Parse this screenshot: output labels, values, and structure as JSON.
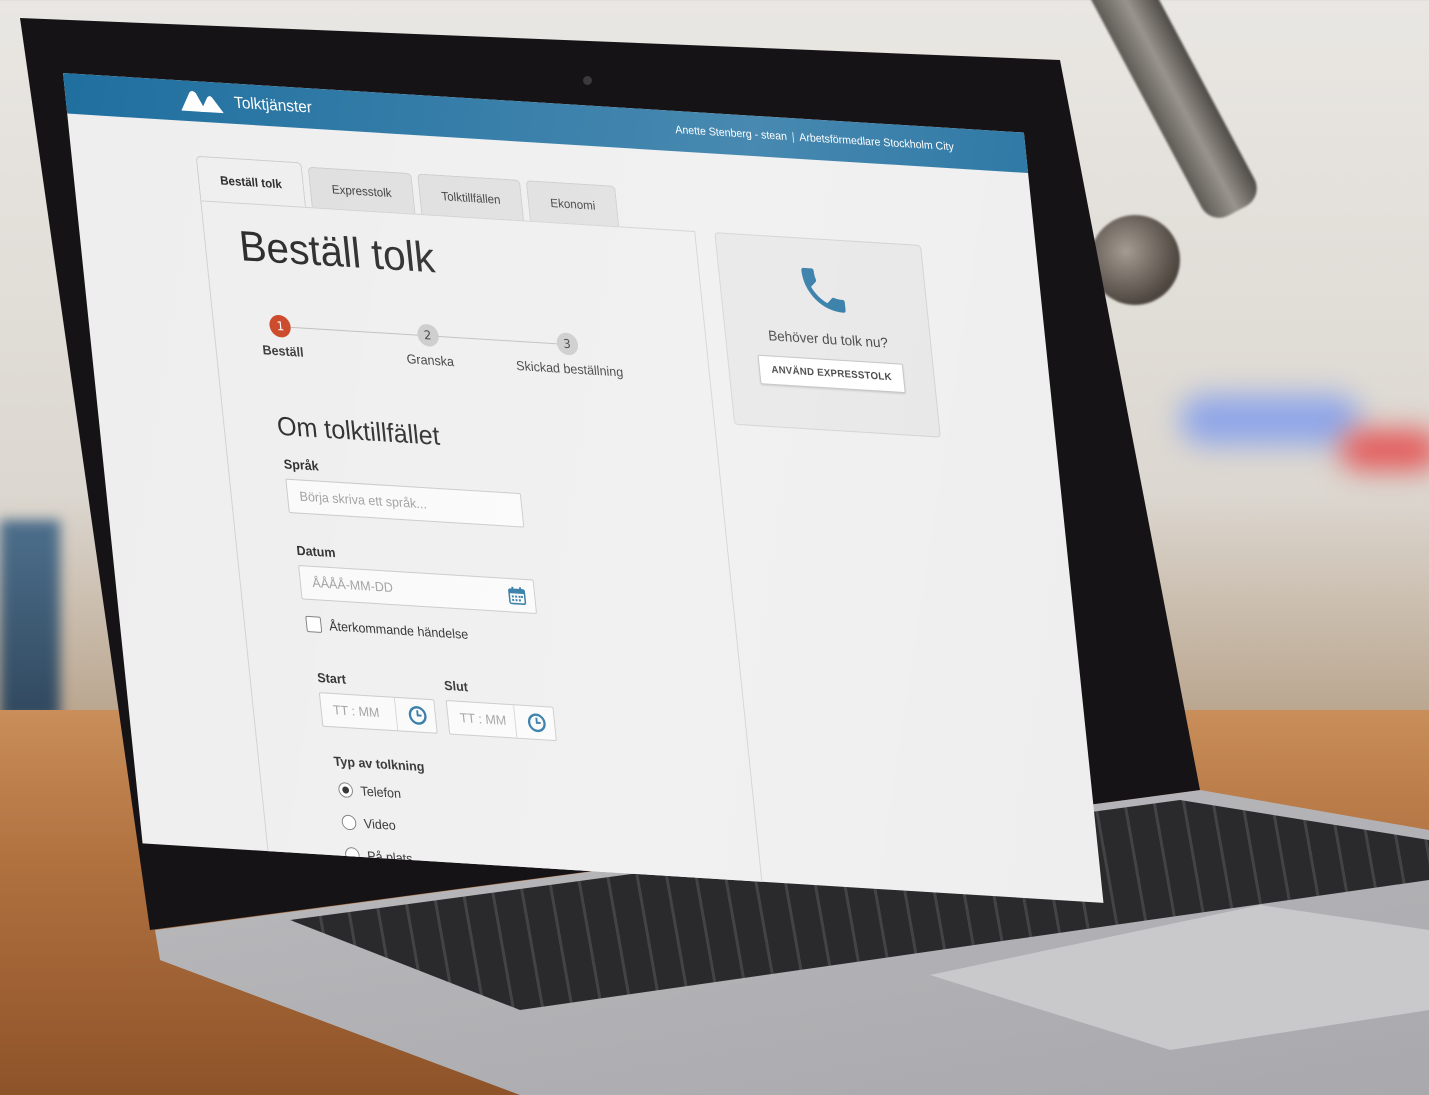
{
  "app": {
    "brand_name": "Tolktjänster",
    "user_name": "Anette Stenberg - stean",
    "organization": "Arbetsförmedlare Stockholm City",
    "accent_color": "#1f6f9f"
  },
  "tabs": [
    {
      "label": "Beställ tolk",
      "active": true
    },
    {
      "label": "Expresstolk",
      "active": false
    },
    {
      "label": "Tolktillfällen",
      "active": false
    },
    {
      "label": "Ekonomi",
      "active": false
    }
  ],
  "main": {
    "title": "Beställ tolk",
    "steps": [
      {
        "number": "1",
        "label": "Beställ",
        "active": true
      },
      {
        "number": "2",
        "label": "Granska",
        "active": false
      },
      {
        "number": "3",
        "label": "Skickad beställning",
        "active": false
      }
    ],
    "section_title": "Om tolktillfället",
    "language": {
      "label": "Språk",
      "placeholder": "Börja skriva ett språk..."
    },
    "date": {
      "label": "Datum",
      "placeholder": "ÅÅÅÅ-MM-DD",
      "icon": "calendar-icon"
    },
    "recurring": {
      "label": "Återkommande händelse",
      "checked": false
    },
    "start": {
      "label": "Start",
      "placeholder": "TT : MM",
      "icon": "clock-icon"
    },
    "end": {
      "label": "Slut",
      "placeholder": "TT : MM",
      "icon": "clock-icon"
    },
    "interpretation_type": {
      "label": "Typ av tolkning",
      "options": [
        {
          "label": "Telefon",
          "checked": true
        },
        {
          "label": "Video",
          "checked": false
        },
        {
          "label": "På plats",
          "checked": false
        }
      ]
    }
  },
  "side": {
    "question": "Behöver du tolk nu?",
    "button_label": "ANVÄND EXPRESSTOLK",
    "icon": "phone-icon"
  }
}
